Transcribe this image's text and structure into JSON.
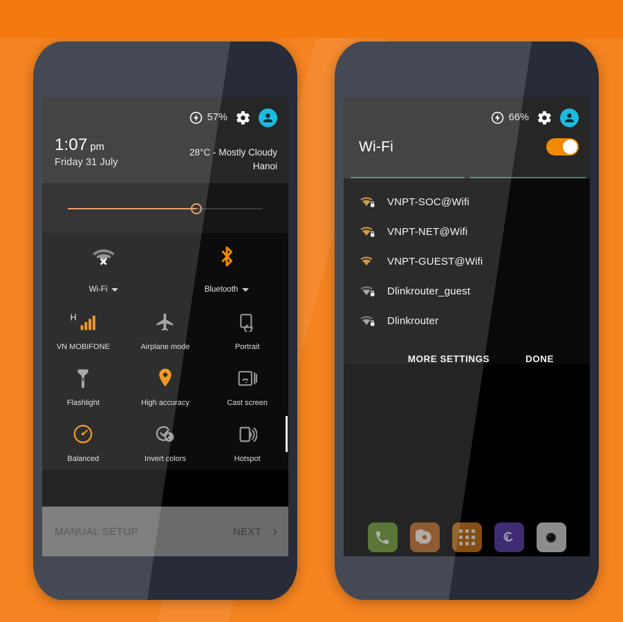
{
  "theme": {
    "background": "#F47A10",
    "accent_orange": "#F08A00",
    "accent_cyan": "#1BBBE0",
    "teal_line": "#2F8B78",
    "panel_dark": "#262626",
    "screen_black": "#0C0C0C"
  },
  "left_phone": {
    "status": {
      "battery_icon": "battery-saver-icon",
      "battery_percent": "57%",
      "settings_icon": "gear-icon",
      "user_icon": "user-avatar-icon"
    },
    "clock": {
      "time": "1:07",
      "ampm": "pm",
      "date": "Friday 31 July"
    },
    "weather": {
      "conditions": "28°C - Mostly Cloudy",
      "location": "Hanoi"
    },
    "brightness": {
      "label": "brightness-slider",
      "value_percent": 66
    },
    "primary_tiles": [
      {
        "label": "Wi-Fi",
        "icon": "wifi-off-icon",
        "state": "off",
        "has_caret": true
      },
      {
        "label": "Bluetooth",
        "icon": "bluetooth-icon",
        "state": "on",
        "has_caret": true
      }
    ],
    "tiles": [
      {
        "label": "VN MOBIFONE",
        "icon": "signal-h-icon",
        "state": "on"
      },
      {
        "label": "Airplane mode",
        "icon": "airplane-icon",
        "state": "off"
      },
      {
        "label": "Portrait",
        "icon": "screen-rotation-icon",
        "state": "off"
      },
      {
        "label": "Flashlight",
        "icon": "flashlight-icon",
        "state": "off"
      },
      {
        "label": "High accuracy",
        "icon": "location-pin-icon",
        "state": "on"
      },
      {
        "label": "Cast screen",
        "icon": "cast-screen-icon",
        "state": "off"
      },
      {
        "label": "Balanced",
        "icon": "performance-gauge-icon",
        "state": "on"
      },
      {
        "label": "Invert colors",
        "icon": "invert-colors-icon",
        "state": "off"
      },
      {
        "label": "Hotspot",
        "icon": "hotspot-icon",
        "state": "off"
      }
    ],
    "setup_bar": {
      "manual_label": "MANUAL SETUP",
      "next_label": "NEXT",
      "next_icon": "chevron-right-icon"
    }
  },
  "right_phone": {
    "status": {
      "battery_icon": "battery-saver-icon",
      "battery_percent": "66%",
      "settings_icon": "gear-icon",
      "user_icon": "user-avatar-icon"
    },
    "wifi": {
      "title": "Wi-Fi",
      "toggle_state": "on",
      "networks": [
        {
          "ssid": "VNPT-SOC@Wifi",
          "icon": "wifi-signal-icon",
          "secured": true,
          "signal": "strong"
        },
        {
          "ssid": "VNPT-NET@Wifi",
          "icon": "wifi-signal-icon",
          "secured": true,
          "signal": "strong"
        },
        {
          "ssid": "VNPT-GUEST@Wifi",
          "icon": "wifi-signal-icon",
          "secured": false,
          "signal": "strong"
        },
        {
          "ssid": "Dlinkrouter_guest",
          "icon": "wifi-signal-icon",
          "secured": true,
          "signal": "weak"
        },
        {
          "ssid": "Dlinkrouter",
          "icon": "wifi-signal-icon",
          "secured": true,
          "signal": "weak"
        }
      ],
      "more_settings_label": "MORE SETTINGS",
      "done_label": "DONE"
    },
    "dock": [
      {
        "name": "phone-app-icon",
        "color": "#5E8A21",
        "glyph": "phone"
      },
      {
        "name": "messaging-app-icon",
        "color": "#B35C18",
        "glyph": "message"
      },
      {
        "name": "app-drawer-icon",
        "color": "#C07018",
        "glyph": "grid"
      },
      {
        "name": "browser-app-icon",
        "color": "#5B3FA8",
        "glyph": "swirl"
      },
      {
        "name": "camera-app-icon",
        "color": "#C9C9C9",
        "glyph": "camera"
      }
    ]
  }
}
